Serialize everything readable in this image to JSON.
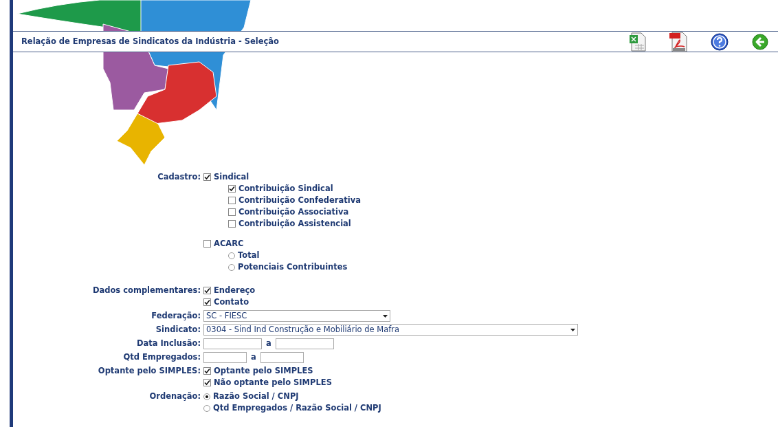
{
  "header": {
    "title": "Relação de Empresas de Sindicatos da Indústria - Seleção"
  },
  "form": [
    {
      "kind": "tree",
      "label": "Cadastro:",
      "groups": [
        {
          "label": "Sindical",
          "checked": true,
          "options": [
            {
              "kind": "checkbox",
              "label": "Contribuição Sindical",
              "checked": true
            },
            {
              "kind": "checkbox",
              "label": "Contribuição Confederativa",
              "checked": false
            },
            {
              "kind": "checkbox",
              "label": "Contribuição Associativa",
              "checked": false
            },
            {
              "kind": "checkbox",
              "label": "Contribuição Assistencial",
              "checked": false
            }
          ]
        },
        {
          "label": "ACARC",
          "checked": false,
          "options": [
            {
              "kind": "radio",
              "label": "Total",
              "selected": false
            },
            {
              "kind": "radio",
              "label": "Potenciais Contribuintes",
              "selected": false
            }
          ]
        }
      ]
    },
    {
      "kind": "checkboxes",
      "label": "Dados complementares:",
      "options": [
        {
          "label": "Endereço",
          "checked": true
        },
        {
          "label": "Contato",
          "checked": true
        }
      ]
    },
    {
      "kind": "select",
      "label": "Federação:",
      "value": "SC - FIESC"
    },
    {
      "kind": "select",
      "label": "Sindicato:",
      "value": "0304 - Sind Ind Construção e Mobiliário de Mafra"
    },
    {
      "kind": "range",
      "label": "Data Inclusão:",
      "separator": "a"
    },
    {
      "kind": "range",
      "label": "Qtd Empregados:",
      "separator": "a"
    },
    {
      "kind": "checkboxes",
      "label": "Optante pelo SIMPLES:",
      "options": [
        {
          "label": "Optante pelo SIMPLES",
          "checked": true
        },
        {
          "label": "Não optante pelo SIMPLES",
          "checked": true
        }
      ]
    },
    {
      "kind": "radios",
      "label": "Ordenação:",
      "options": [
        {
          "label": "Razão Social / CNPJ",
          "selected": true
        },
        {
          "label": "Qtd Empregados / Razão Social / CNPJ",
          "selected": false
        }
      ]
    }
  ]
}
